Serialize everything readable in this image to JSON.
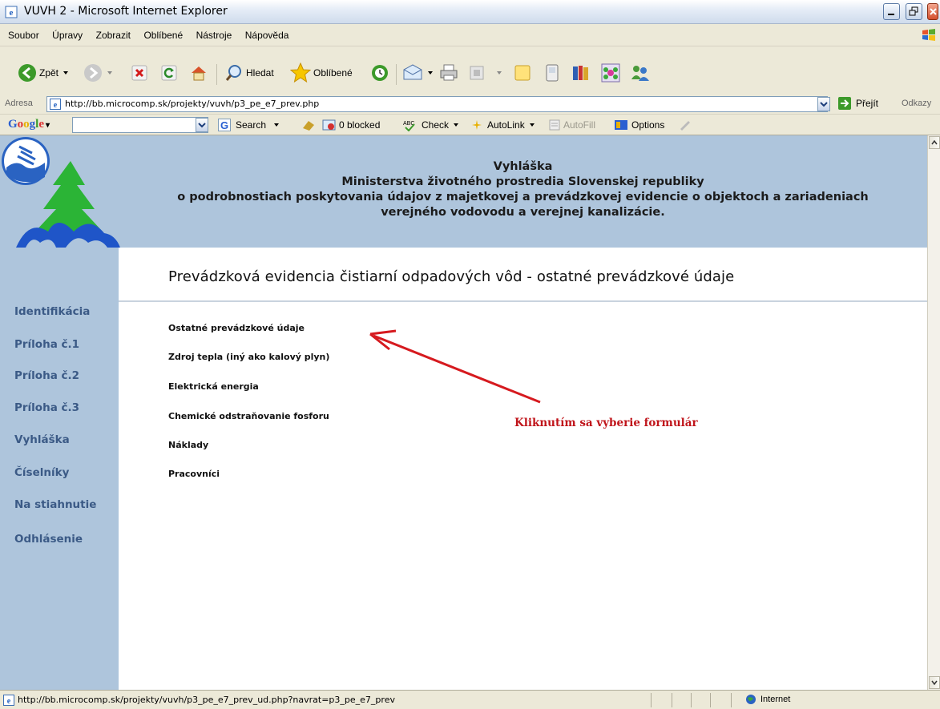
{
  "window": {
    "title": "VUVH 2 - Microsoft Internet Explorer"
  },
  "menubar": {
    "items": [
      "Soubor",
      "Úpravy",
      "Zobrazit",
      "Oblíbené",
      "Nástroje",
      "Nápověda"
    ]
  },
  "toolbar": {
    "back_label": "Zpět",
    "search_label": "Hledat",
    "favorites_label": "Oblíbené"
  },
  "addressbar": {
    "label": "Adresa",
    "url": "http://bb.microcomp.sk/projekty/vuvh/p3_pe_e7_prev.php",
    "go_label": "Přejít",
    "links_label": "Odkazy"
  },
  "googlebar": {
    "logo": "Google",
    "search_label": "Search",
    "blocked_label": "0 blocked",
    "check_label": "Check",
    "autolink_label": "AutoLink",
    "autofill_label": "AutoFill",
    "options_label": "Options"
  },
  "header": {
    "line1": "Vyhláška",
    "line2": "Ministerstva životného prostredia Slovenskej republiky",
    "line3": "o podrobnostiach poskytovania údajov z majetkovej a prevádzkovej evidencie o objektoch a zariadeniach",
    "line4": "verejného vodovodu a verejnej kanalizácie."
  },
  "sidebar": {
    "items": [
      "Identifikácia",
      "Príloha č.1",
      "Príloha č.2",
      "Príloha č.3",
      "Vyhláška",
      "Číselníky",
      "Na stiahnutie",
      "Odhlásenie"
    ]
  },
  "main": {
    "title": "Prevádzková evidencia čistiarní odpadových vôd - ostatné prevádzkové údaje",
    "links": [
      "Ostatné prevádzkové údaje",
      "Zdroj tepla (iný ako kalový plyn)",
      "Elektrická energia",
      "Chemické odstraňovanie fosforu",
      "Náklady",
      "Pracovníci"
    ],
    "annotation": "Kliknutím sa vyberie formulár"
  },
  "statusbar": {
    "url": "http://bb.microcomp.sk/projekty/vuvh/p3_pe_e7_prev_ud.php?navrat=p3_pe_e7_prev",
    "zone": "Internet"
  },
  "colors": {
    "header_bg": "#aec5dc",
    "sidebar_link": "#3b5a86",
    "annotation": "#c0151b"
  }
}
